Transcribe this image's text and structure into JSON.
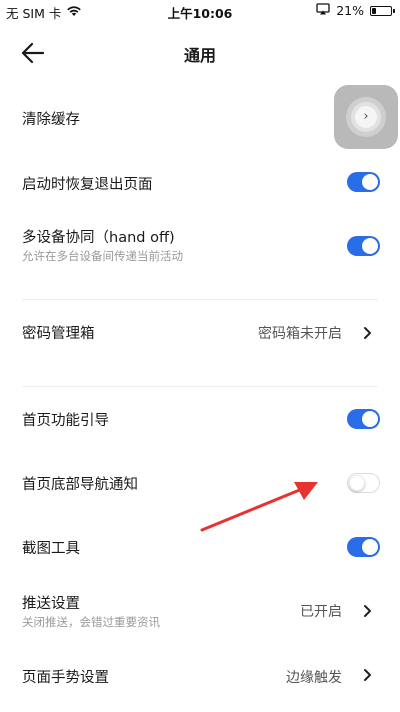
{
  "status_bar": {
    "carrier": "无 SIM 卡",
    "time": "上午10:06",
    "battery_percent": "21%",
    "battery_level": 0.21,
    "icons": [
      "wifi-icon",
      "screen-mirroring-icon",
      "battery-icon"
    ]
  },
  "nav": {
    "title": "通用",
    "back_icon": "back-arrow-icon"
  },
  "settings": {
    "clear_cache": {
      "label": "清除缓存"
    },
    "restore_pages": {
      "label": "启动时恢复退出页面",
      "enabled": true
    },
    "handoff": {
      "label": "多设备协同（hand off)",
      "sublabel": "允许在多台设备间传递当前活动",
      "enabled": true
    },
    "password_manager": {
      "label": "密码管理箱",
      "value": "密码箱未开启"
    },
    "home_guide": {
      "label": "首页功能引导",
      "enabled": true
    },
    "home_bottom_nav": {
      "label": "首页底部导航通知",
      "enabled": false
    },
    "screenshot_tool": {
      "label": "截图工具",
      "enabled": true
    },
    "push_settings": {
      "label": "推送设置",
      "sublabel": "关闭推送，会错过重要资讯",
      "value": "已开启"
    },
    "gesture_settings": {
      "label": "页面手势设置",
      "value": "边缘触发"
    }
  },
  "colors": {
    "toggle_on": "#2a6de8",
    "annotation_arrow": "#e8322f"
  }
}
